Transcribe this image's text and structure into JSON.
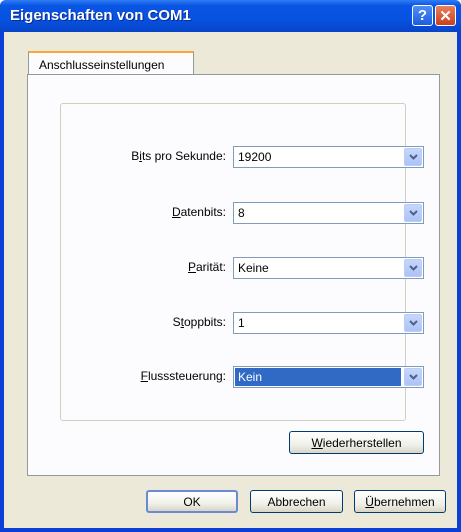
{
  "window": {
    "title": "Eigenschaften von COM1"
  },
  "titlebar": {
    "help_glyph": "?",
    "close_glyph": "✕"
  },
  "tabs": [
    {
      "label": "Anschlusseinstellungen",
      "active": true
    }
  ],
  "settings": [
    {
      "label_pre": "B",
      "label_ul": "i",
      "label_post": "ts pro Sekunde:",
      "value": "19200"
    },
    {
      "label_pre": "",
      "label_ul": "D",
      "label_post": "atenbits:",
      "value": "8"
    },
    {
      "label_pre": "",
      "label_ul": "P",
      "label_post": "arität:",
      "value": "Keine"
    },
    {
      "label_pre": "S",
      "label_ul": "t",
      "label_post": "oppbits:",
      "value": "1"
    },
    {
      "label_pre": "",
      "label_ul": "F",
      "label_post": "lusssteuerung:",
      "value": "Kein",
      "selected": true
    }
  ],
  "restore_button": {
    "pre": "",
    "ul": "W",
    "post": "iederherstellen"
  },
  "footer": {
    "ok": "OK",
    "cancel": "Abbrechen",
    "apply_ul": "Ü",
    "apply_post": "bernehmen"
  },
  "colors": {
    "titlebar": "#0752e0",
    "dialog": "#ece9d8",
    "tab_accent": "#f6a935",
    "selection": "#316ac5"
  }
}
